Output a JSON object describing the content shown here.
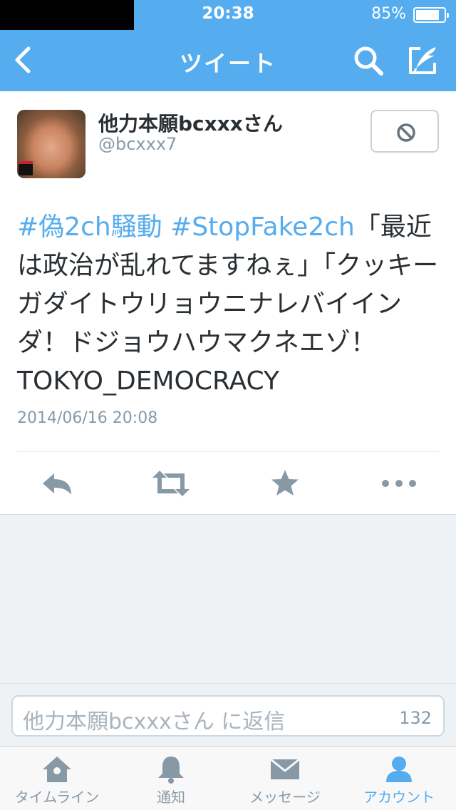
{
  "status_bar": {
    "time": "20:38",
    "battery": "85%",
    "battery_level": 0.85
  },
  "nav": {
    "title": "ツイート"
  },
  "tweet": {
    "author_name": "他力本願bcxxxさん",
    "author_handle": "@bcxxx7",
    "hashtag_1": "#偽2ch騒動",
    "hashtag_2": "#StopFake2ch",
    "body_text": "「最近は政治が乱れてますねぇ」「クッキーガダイトウリョウニナレバイインダ！ドジョウハウマクネエゾ！ TOKYO_DEMOCRACY",
    "timestamp": "2014/06/16 20:08"
  },
  "reply": {
    "placeholder": "他力本願bcxxxさん に返信",
    "char_count": "132"
  },
  "tabs": [
    {
      "label": "タイムライン",
      "icon": "home-icon"
    },
    {
      "label": "通知",
      "icon": "bell-icon"
    },
    {
      "label": "メッセージ",
      "icon": "envelope-icon"
    },
    {
      "label": "アカウント",
      "icon": "person-icon",
      "active": true
    }
  ],
  "colors": {
    "brand": "#55acee",
    "text": "#292f33",
    "muted": "#8899a6",
    "action_icon": "#8899a6"
  }
}
